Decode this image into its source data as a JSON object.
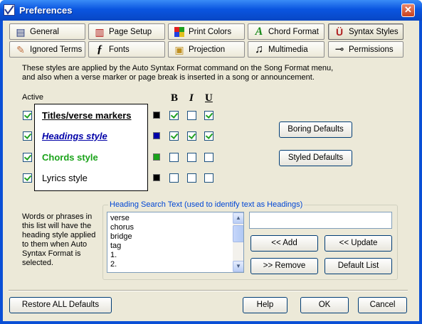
{
  "window": {
    "title": "Preferences",
    "close": "✕"
  },
  "tabs": [
    {
      "label": "General",
      "icon": "document-icon",
      "glyph": "▤"
    },
    {
      "label": "Page Setup",
      "icon": "page-setup-icon",
      "glyph": "▥"
    },
    {
      "label": "Print Colors",
      "icon": "color-grid-icon",
      "glyph": "▦"
    },
    {
      "label": "Chord Format",
      "icon": "letter-a-icon",
      "glyph": "A"
    },
    {
      "label": "Syntax Styles",
      "icon": "syntax-icon",
      "glyph": "Ü"
    },
    {
      "label": "Ignored Terms",
      "icon": "eraser-icon",
      "glyph": "✎"
    },
    {
      "label": "Fonts",
      "icon": "font-icon",
      "glyph": "ƒ"
    },
    {
      "label": "Projection",
      "icon": "projection-icon",
      "glyph": "▣"
    },
    {
      "label": "Multimedia",
      "icon": "music-note-icon",
      "glyph": "♫"
    },
    {
      "label": "Permissions",
      "icon": "key-icon",
      "glyph": "⊸"
    }
  ],
  "selected_tab": "Syntax Styles",
  "description_line1": "These styles are applied by the Auto Syntax Format command on the Song Format menu,",
  "description_line2": "and also when a verse marker or page break is inserted in a song or announcement.",
  "active_label": "Active",
  "format_headers": {
    "bold": "B",
    "italic": "I",
    "underline": "U"
  },
  "styles": [
    {
      "name": "Titles/verse markers",
      "active": true,
      "color": "#000000",
      "bold": true,
      "italic": false,
      "underline": true
    },
    {
      "name": "Headings style",
      "active": true,
      "color": "#0000a8",
      "bold": true,
      "italic": true,
      "underline": true
    },
    {
      "name": "Chords style",
      "active": true,
      "color": "#1aa31a",
      "bold": false,
      "italic": false,
      "underline": false
    },
    {
      "name": "Lyrics style",
      "active": true,
      "color": "#000000",
      "bold": false,
      "italic": false,
      "underline": false
    }
  ],
  "buttons": {
    "boring_defaults": "Boring Defaults",
    "styled_defaults": "Styled Defaults",
    "add": "<< Add",
    "update": "<< Update",
    "remove": ">> Remove",
    "default_list": "Default List",
    "restore_all": "Restore ALL Defaults",
    "help": "Help",
    "ok": "OK",
    "cancel": "Cancel"
  },
  "heading_search": {
    "legend": "Heading Search Text (used to identify text as Headings)",
    "items": [
      "verse",
      "chorus",
      "bridge",
      "tag",
      "1.",
      "2."
    ],
    "input_value": ""
  },
  "help_text": "Words or phrases in this list will have the heading style applied to them when Auto Syntax Format is selected."
}
